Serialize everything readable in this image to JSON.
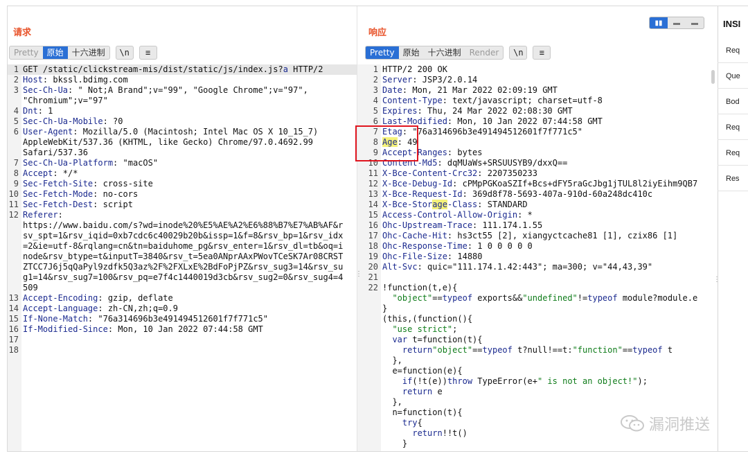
{
  "request": {
    "title": "请求",
    "tabs": [
      "Pretty",
      "原始",
      "十六进制"
    ],
    "active_tab": "原始",
    "newline_btn": "\\n",
    "menu_btn": "≡",
    "lines": [
      {
        "n": "1",
        "segs": [
          [
            "GET /static/clickstream-mis/dist/static/js/index.js?",
            ""
          ],
          [
            "a",
            "k"
          ],
          [
            " HTTP/2",
            ""
          ]
        ]
      },
      {
        "n": "2",
        "segs": [
          [
            "Host",
            "k"
          ],
          [
            ": bkssl.bdimg.com",
            ""
          ]
        ]
      },
      {
        "n": "3",
        "segs": [
          [
            "Sec-Ch-Ua",
            "k"
          ],
          [
            ": \" Not;A Brand\";v=\"99\", \"Google Chrome\";v=\"97\",",
            ""
          ]
        ]
      },
      {
        "n": "",
        "segs": [
          [
            "\"Chromium\";v=\"97\"",
            ""
          ]
        ]
      },
      {
        "n": "4",
        "segs": [
          [
            "Dnt",
            "k"
          ],
          [
            ": 1",
            ""
          ]
        ]
      },
      {
        "n": "5",
        "segs": [
          [
            "Sec-Ch-Ua-Mobile",
            "k"
          ],
          [
            ": ?0",
            ""
          ]
        ]
      },
      {
        "n": "6",
        "segs": [
          [
            "User-Agent",
            "k"
          ],
          [
            ": Mozilla/5.0 (Macintosh; Intel Mac OS X 10_15_7)",
            ""
          ]
        ]
      },
      {
        "n": "",
        "segs": [
          [
            "AppleWebKit/537.36 (KHTML, like Gecko) Chrome/97.0.4692.99",
            ""
          ]
        ]
      },
      {
        "n": "",
        "segs": [
          [
            "Safari/537.36",
            ""
          ]
        ]
      },
      {
        "n": "7",
        "segs": [
          [
            "Sec-Ch-Ua-Platform",
            "k"
          ],
          [
            ": \"macOS\"",
            ""
          ]
        ]
      },
      {
        "n": "8",
        "segs": [
          [
            "Accept",
            "k"
          ],
          [
            ": */*",
            ""
          ]
        ]
      },
      {
        "n": "9",
        "segs": [
          [
            "Sec-Fetch-Site",
            "k"
          ],
          [
            ": cross-site",
            ""
          ]
        ]
      },
      {
        "n": "10",
        "segs": [
          [
            "Sec-Fetch-Mode",
            "k"
          ],
          [
            ": no-cors",
            ""
          ]
        ]
      },
      {
        "n": "11",
        "segs": [
          [
            "Sec-Fetch-Dest",
            "k"
          ],
          [
            ": script",
            ""
          ]
        ]
      },
      {
        "n": "12",
        "segs": [
          [
            "Referer",
            "k"
          ],
          [
            ":",
            ""
          ]
        ]
      },
      {
        "n": "",
        "segs": [
          [
            "https://www.baidu.com/s?wd=inode%20%E5%AE%A2%E6%88%B7%E7%AB%AF&r",
            ""
          ]
        ]
      },
      {
        "n": "",
        "segs": [
          [
            "sv_spt=1&rsv_iqid=0xb7cdc6c40029b20b&issp=1&f=8&rsv_bp=1&rsv_idx",
            ""
          ]
        ]
      },
      {
        "n": "",
        "segs": [
          [
            "=2&ie=utf-8&rqlang=cn&tn=baiduhome_pg&rsv_enter=1&rsv_dl=tb&oq=i",
            ""
          ]
        ]
      },
      {
        "n": "",
        "segs": [
          [
            "node&rsv_btype=t&inputT=3840&rsv_t=5ea0ANprAAxPWovTCeSK7Ar08CRST",
            ""
          ]
        ]
      },
      {
        "n": "",
        "segs": [
          [
            "ZTCC7J6j5qQaPyl9zdfk5Q3az%2F%2FXLxE%2BdFoPjPZ&rsv_sug3=14&rsv_su",
            ""
          ]
        ]
      },
      {
        "n": "",
        "segs": [
          [
            "g1=14&rsv_sug7=100&rsv_pq=e7f4c1440019d3cb&rsv_sug2=0&rsv_sug4=4",
            ""
          ]
        ]
      },
      {
        "n": "",
        "segs": [
          [
            "509",
            ""
          ]
        ]
      },
      {
        "n": "13",
        "segs": [
          [
            "Accept-Encoding",
            "k"
          ],
          [
            ": gzip, deflate",
            ""
          ]
        ]
      },
      {
        "n": "14",
        "segs": [
          [
            "Accept-Language",
            "k"
          ],
          [
            ": zh-CN,zh;q=0.9",
            ""
          ]
        ]
      },
      {
        "n": "15",
        "segs": [
          [
            "If-None-Match",
            "k"
          ],
          [
            ": \"76a314696b3e491494512601f7f771c5\"",
            ""
          ]
        ]
      },
      {
        "n": "16",
        "segs": [
          [
            "If-Modified-Since",
            "k"
          ],
          [
            ": Mon, 10 Jan 2022 07:44:58 GMT",
            ""
          ]
        ]
      },
      {
        "n": "17",
        "segs": [
          [
            "",
            ""
          ]
        ]
      },
      {
        "n": "18",
        "segs": [
          [
            "",
            ""
          ]
        ]
      }
    ]
  },
  "response": {
    "title": "响应",
    "tabs": [
      "Pretty",
      "原始",
      "十六进制",
      "Render"
    ],
    "active_tab": "Pretty",
    "newline_btn": "\\n",
    "menu_btn": "≡",
    "lines": [
      {
        "n": "1",
        "segs": [
          [
            "HTTP/2 200 OK",
            ""
          ]
        ]
      },
      {
        "n": "2",
        "segs": [
          [
            "Server",
            "k"
          ],
          [
            ": JSP3/2.0.14",
            ""
          ]
        ]
      },
      {
        "n": "3",
        "segs": [
          [
            "Date",
            "k"
          ],
          [
            ": Mon, 21 Mar 2022 02:09:19 GMT",
            ""
          ]
        ]
      },
      {
        "n": "4",
        "segs": [
          [
            "Content-Type",
            "k"
          ],
          [
            ": text/javascript; charset=utf-8",
            ""
          ]
        ]
      },
      {
        "n": "5",
        "segs": [
          [
            "Expires",
            "k"
          ],
          [
            ": Thu, 24 Mar 2022 02:08:30 GMT",
            ""
          ]
        ]
      },
      {
        "n": "6",
        "segs": [
          [
            "Last-Modified",
            "k"
          ],
          [
            ": Mon, 10 Jan 2022 07:44:58 GMT",
            ""
          ]
        ]
      },
      {
        "n": "7",
        "segs": [
          [
            "Etag",
            "k"
          ],
          [
            ": \"76a314696b3e491494512601f7f771c5\"",
            ""
          ]
        ]
      },
      {
        "n": "8",
        "segs": [
          [
            "Age",
            "hlk"
          ],
          [
            ": 49",
            ""
          ]
        ]
      },
      {
        "n": "9",
        "segs": [
          [
            "Accept-Ranges",
            "k"
          ],
          [
            ": bytes",
            ""
          ]
        ]
      },
      {
        "n": "10",
        "segs": [
          [
            "Content-Md5",
            "k"
          ],
          [
            ": dqMUaWs+SRSUUSYB9/dxxQ==",
            ""
          ]
        ]
      },
      {
        "n": "11",
        "segs": [
          [
            "X-Bce-Content-Crc32",
            "k"
          ],
          [
            ": 2207350233",
            ""
          ]
        ]
      },
      {
        "n": "12",
        "segs": [
          [
            "X-Bce-Debug-Id",
            "k"
          ],
          [
            ": cPMpPGKoaSZIf+Bcs+dFY5raGcJbg1jTUL8l2iyEihm9QB7",
            ""
          ]
        ]
      },
      {
        "n": "13",
        "segs": [
          [
            "X-Bce-Request-Id",
            "k"
          ],
          [
            ": 369d8f78-5693-407a-910d-60a248dc410c",
            ""
          ]
        ]
      },
      {
        "n": "14",
        "segs": [
          [
            "X-Bce-Stor",
            "k"
          ],
          [
            "age",
            "hlk"
          ],
          [
            "-Class",
            "k"
          ],
          [
            ": STANDARD",
            ""
          ]
        ]
      },
      {
        "n": "15",
        "segs": [
          [
            "Access-Control-Allow-Origin",
            "k"
          ],
          [
            ": *",
            ""
          ]
        ]
      },
      {
        "n": "16",
        "segs": [
          [
            "Ohc-Upstream-Trace",
            "k"
          ],
          [
            ": 111.174.1.55",
            ""
          ]
        ]
      },
      {
        "n": "17",
        "segs": [
          [
            "Ohc-Cache-Hit",
            "k"
          ],
          [
            ": hs3ct55 [2], xiangyctcache81 [1], czix86 [1]",
            ""
          ]
        ]
      },
      {
        "n": "18",
        "segs": [
          [
            "Ohc-Response-Time",
            "k"
          ],
          [
            ": 1 0 0 0 0 0",
            ""
          ]
        ]
      },
      {
        "n": "19",
        "segs": [
          [
            "Ohc-File-Size",
            "k"
          ],
          [
            ": 14880",
            ""
          ]
        ]
      },
      {
        "n": "20",
        "segs": [
          [
            "Alt-Svc",
            "k"
          ],
          [
            ": quic=\"111.174.1.42:443\"; ma=300; v=\"44,43,39\"",
            ""
          ]
        ]
      },
      {
        "n": "21",
        "segs": [
          [
            "",
            ""
          ]
        ]
      },
      {
        "n": "22",
        "segs": [
          [
            "!function(t,e){",
            ""
          ]
        ]
      },
      {
        "n": "",
        "segs": [
          [
            "  ",
            ""
          ],
          [
            "\"object\"",
            "s"
          ],
          [
            "==",
            ""
          ],
          [
            "typeof",
            "kw"
          ],
          [
            " exports&&",
            ""
          ],
          [
            "\"undefined\"",
            "s"
          ],
          [
            "!=",
            ""
          ],
          [
            "typeof",
            "kw"
          ],
          [
            " module?module.e",
            ""
          ]
        ]
      },
      {
        "n": "",
        "segs": [
          [
            "}",
            ""
          ]
        ]
      },
      {
        "n": "",
        "segs": [
          [
            "(this,(function(){",
            ""
          ]
        ]
      },
      {
        "n": "",
        "segs": [
          [
            "  ",
            ""
          ],
          [
            "\"use strict\"",
            "s"
          ],
          [
            ";",
            ""
          ]
        ]
      },
      {
        "n": "",
        "segs": [
          [
            "  ",
            ""
          ],
          [
            "var",
            "kw"
          ],
          [
            " t=function(t){",
            ""
          ]
        ]
      },
      {
        "n": "",
        "segs": [
          [
            "    ",
            ""
          ],
          [
            "return",
            "kw"
          ],
          [
            "\"object\"",
            "s"
          ],
          [
            "==",
            ""
          ],
          [
            "typeof",
            "kw"
          ],
          [
            " t?null!==t:",
            ""
          ],
          [
            "\"function\"",
            "s"
          ],
          [
            "==",
            ""
          ],
          [
            "typeof",
            "kw"
          ],
          [
            " t",
            ""
          ]
        ]
      },
      {
        "n": "",
        "segs": [
          [
            "  },",
            ""
          ]
        ]
      },
      {
        "n": "",
        "segs": [
          [
            "  e=function(e){",
            ""
          ]
        ]
      },
      {
        "n": "",
        "segs": [
          [
            "    ",
            ""
          ],
          [
            "if",
            "kw"
          ],
          [
            "(!t(e))",
            ""
          ],
          [
            "throw",
            "kw"
          ],
          [
            " TypeError(e+",
            ""
          ],
          [
            "\" is not an object!\"",
            "s"
          ],
          [
            ");",
            ""
          ]
        ]
      },
      {
        "n": "",
        "segs": [
          [
            "    ",
            ""
          ],
          [
            "return",
            "kw"
          ],
          [
            " e",
            ""
          ]
        ]
      },
      {
        "n": "",
        "segs": [
          [
            "  },",
            ""
          ]
        ]
      },
      {
        "n": "",
        "segs": [
          [
            "  n=function(t){",
            ""
          ]
        ]
      },
      {
        "n": "",
        "segs": [
          [
            "    ",
            ""
          ],
          [
            "try",
            "kw"
          ],
          [
            "{",
            ""
          ]
        ]
      },
      {
        "n": "",
        "segs": [
          [
            "      ",
            ""
          ],
          [
            "return",
            "kw"
          ],
          [
            "!!t()",
            ""
          ]
        ]
      },
      {
        "n": "",
        "segs": [
          [
            "    }",
            ""
          ]
        ]
      }
    ]
  },
  "inspector": {
    "title": "INSI",
    "items": [
      "Req",
      "Que",
      "Bod",
      "Req",
      "Req",
      "Res"
    ]
  },
  "view_toggle": [
    "▮▮",
    "▬",
    "▬"
  ],
  "watermark": "漏洞推送"
}
